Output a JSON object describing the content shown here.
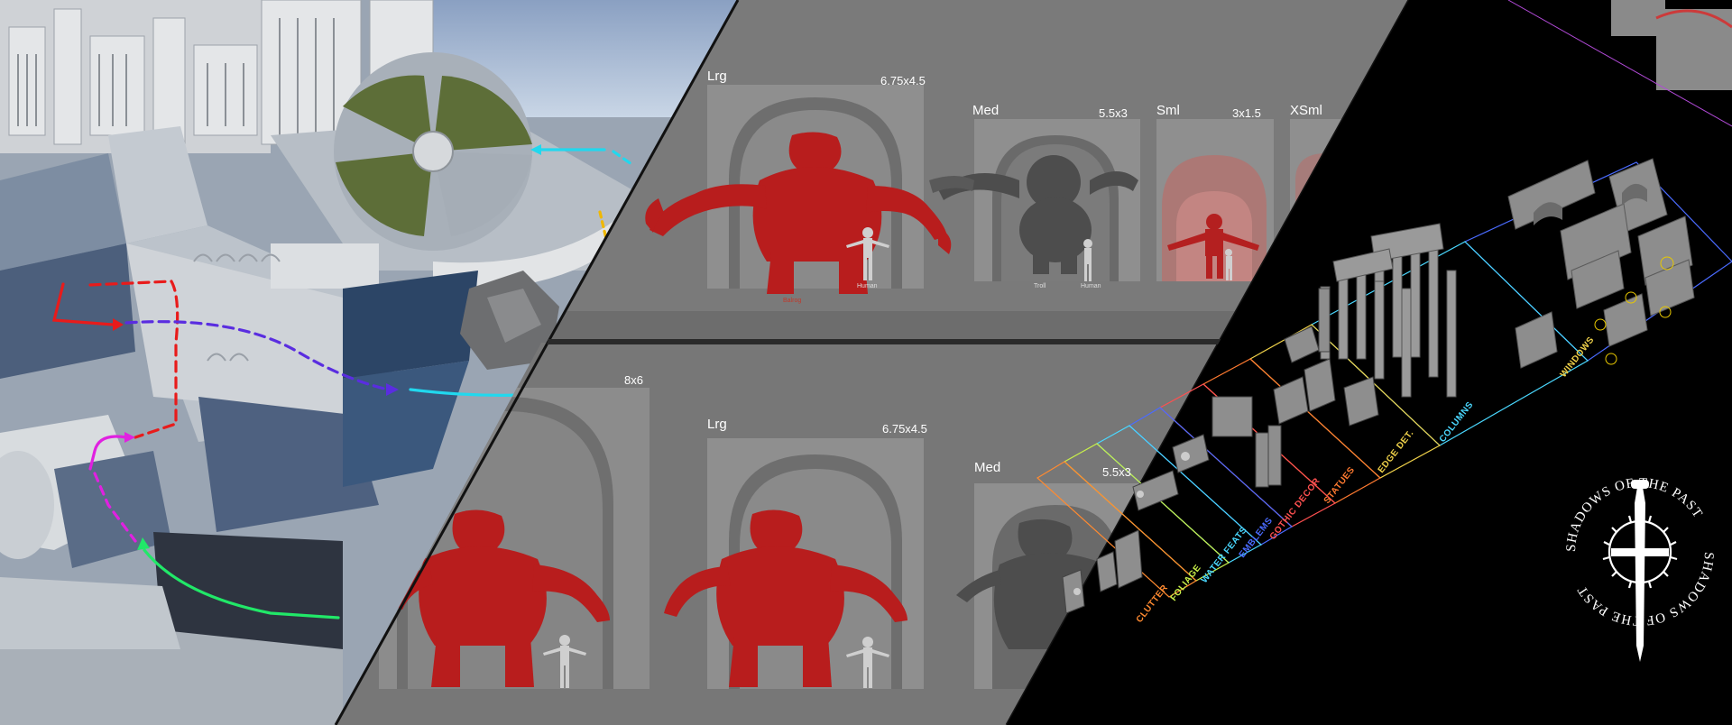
{
  "scale_panel_top": {
    "lrg": {
      "name": "Lrg",
      "dims": "6.75x4.5"
    },
    "med": {
      "name": "Med",
      "dims": "5.5x3"
    },
    "sml": {
      "name": "Sml",
      "dims": "3x1.5"
    },
    "xsml": {
      "name": "XSml"
    }
  },
  "scale_panel_bottom": {
    "big": {
      "dims": "8x6"
    },
    "lrg": {
      "name": "Lrg",
      "dims": "6.75x4.5"
    },
    "med": {
      "name": "Med",
      "dims": "5.5x3"
    }
  },
  "figure_tags": {
    "balrog": "Balrog",
    "human": "Human",
    "troll": "Troll"
  },
  "kit_sections": [
    {
      "label": "WINDOWS",
      "color": "#f0d24a"
    },
    {
      "label": "COLUMNS",
      "color": "#4ad8ff"
    },
    {
      "label": "EDGE DET.",
      "color": "#f0d24a"
    },
    {
      "label": "STATUES",
      "color": "#ff7a30"
    },
    {
      "label": "GOTHIC DECOR",
      "color": "#ff5050"
    },
    {
      "label": "EMBLEMS",
      "color": "#4a6bff"
    },
    {
      "label": "WATER FEATS",
      "color": "#4ad8ff"
    },
    {
      "label": "FOLIAGE",
      "color": "#c8f04a"
    },
    {
      "label": "CLUTTER",
      "color": "#ff8a30"
    }
  ],
  "logo": {
    "text": "SHADOWS OF THE PAST"
  },
  "colors": {
    "troll_red": "#b81d1d",
    "path_red": "#e81b1b",
    "path_purple": "#5a2de0",
    "path_cyan": "#21d8ee",
    "path_green": "#21e868",
    "path_magenta": "#e021e0"
  }
}
